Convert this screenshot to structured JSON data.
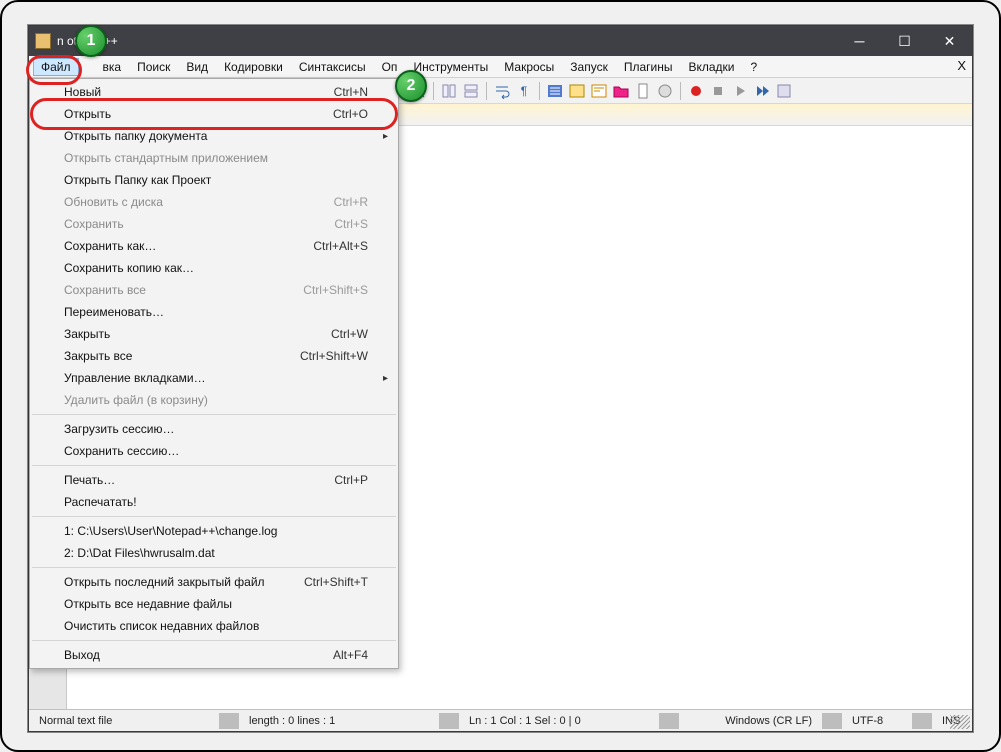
{
  "title": "n         otepad++",
  "menubar": [
    "Файл",
    "вка",
    "Поиск",
    "Вид",
    "Кодировки",
    "Синтаксисы",
    "Оп",
    "Инструменты",
    "Макросы",
    "Запуск",
    "Плагины",
    "Вкладки",
    "?"
  ],
  "close_x": "X",
  "dropdown": [
    {
      "t": "item",
      "label": "Новый",
      "shortcut": "Ctrl+N",
      "disabled": false
    },
    {
      "t": "item",
      "label": "Открыть",
      "shortcut": "Ctrl+O",
      "disabled": false
    },
    {
      "t": "item",
      "label": "Открыть папку документа",
      "submenu": true,
      "disabled": false
    },
    {
      "t": "item",
      "label": "Открыть стандартным приложением",
      "disabled": true
    },
    {
      "t": "item",
      "label": "Открыть Папку как Проект",
      "disabled": false
    },
    {
      "t": "item",
      "label": "Обновить с диска",
      "shortcut": "Ctrl+R",
      "disabled": true
    },
    {
      "t": "item",
      "label": "Сохранить",
      "shortcut": "Ctrl+S",
      "disabled": true
    },
    {
      "t": "item",
      "label": "Сохранить как…",
      "shortcut": "Ctrl+Alt+S",
      "disabled": false
    },
    {
      "t": "item",
      "label": "Сохранить копию как…",
      "disabled": false
    },
    {
      "t": "item",
      "label": "Сохранить все",
      "shortcut": "Ctrl+Shift+S",
      "disabled": true
    },
    {
      "t": "item",
      "label": "Переименовать…",
      "disabled": false
    },
    {
      "t": "item",
      "label": "Закрыть",
      "shortcut": "Ctrl+W",
      "disabled": false
    },
    {
      "t": "item",
      "label": "Закрыть все",
      "shortcut": "Ctrl+Shift+W",
      "disabled": false
    },
    {
      "t": "item",
      "label": "Управление вкладками…",
      "submenu": true,
      "disabled": false
    },
    {
      "t": "item",
      "label": "Удалить файл (в корзину)",
      "disabled": true
    },
    {
      "t": "sep"
    },
    {
      "t": "item",
      "label": "Загрузить сессию…",
      "disabled": false
    },
    {
      "t": "item",
      "label": "Сохранить сессию…",
      "disabled": false
    },
    {
      "t": "sep"
    },
    {
      "t": "item",
      "label": "Печать…",
      "shortcut": "Ctrl+P",
      "disabled": false
    },
    {
      "t": "item",
      "label": "Распечатать!",
      "disabled": false
    },
    {
      "t": "sep"
    },
    {
      "t": "item",
      "label": "1: C:\\Users\\User\\Notepad++\\change.log",
      "disabled": false
    },
    {
      "t": "item",
      "label": "2: D:\\Dat Files\\hwrusalm.dat",
      "disabled": false
    },
    {
      "t": "sep"
    },
    {
      "t": "item",
      "label": "Открыть последний закрытый файл",
      "shortcut": "Ctrl+Shift+T",
      "disabled": false
    },
    {
      "t": "item",
      "label": "Открыть все недавние файлы",
      "disabled": false
    },
    {
      "t": "item",
      "label": "Очистить список недавних файлов",
      "disabled": false
    },
    {
      "t": "sep"
    },
    {
      "t": "item",
      "label": "Выход",
      "shortcut": "Alt+F4",
      "disabled": false
    }
  ],
  "status": {
    "filetype": "Normal text file",
    "len": "length : 0    lines : 1",
    "pos": "Ln : 1    Col : 1    Sel : 0 | 0",
    "eol": "Windows (CR LF)",
    "enc": "UTF-8",
    "ins": "INS"
  },
  "badges": {
    "b1": "1",
    "b2": "2"
  }
}
